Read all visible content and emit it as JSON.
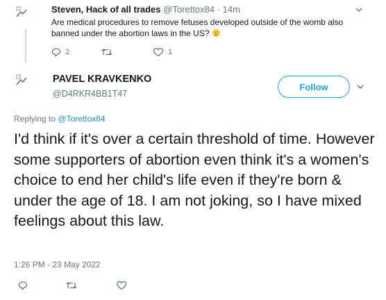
{
  "parent_tweet": {
    "author_name": "Steven, Hack of all trades",
    "handle": "@Torettox84",
    "separator": "·",
    "time": "14m",
    "text": "Are medical procedures to remove fetuses developed outside of the womb also banned under the abortion laws in the US?",
    "emoji_icon": "thinking-face-icon",
    "reply_count": "2",
    "retweet_count": "",
    "like_count": "1"
  },
  "main_tweet": {
    "author_name": "PAVEL KRAVKENKO",
    "handle": "@D4RKR4BB1T47",
    "follow_label": "Follow",
    "replying_to_prefix": "Replying to",
    "replying_to_handle": "@Torettox84",
    "text": "I'd think if it's over a certain threshold of time. However some supporters of abortion even think it's a women's choice to end her child's life even if they're born & under the age of 18. I am not joking, so I have mixed feelings about this law.",
    "timestamp": "1:26 PM - 23 May 2022"
  },
  "colors": {
    "accent": "#1da1f2",
    "link": "#1b95e0",
    "muted": "#657786",
    "text": "#14171a"
  }
}
